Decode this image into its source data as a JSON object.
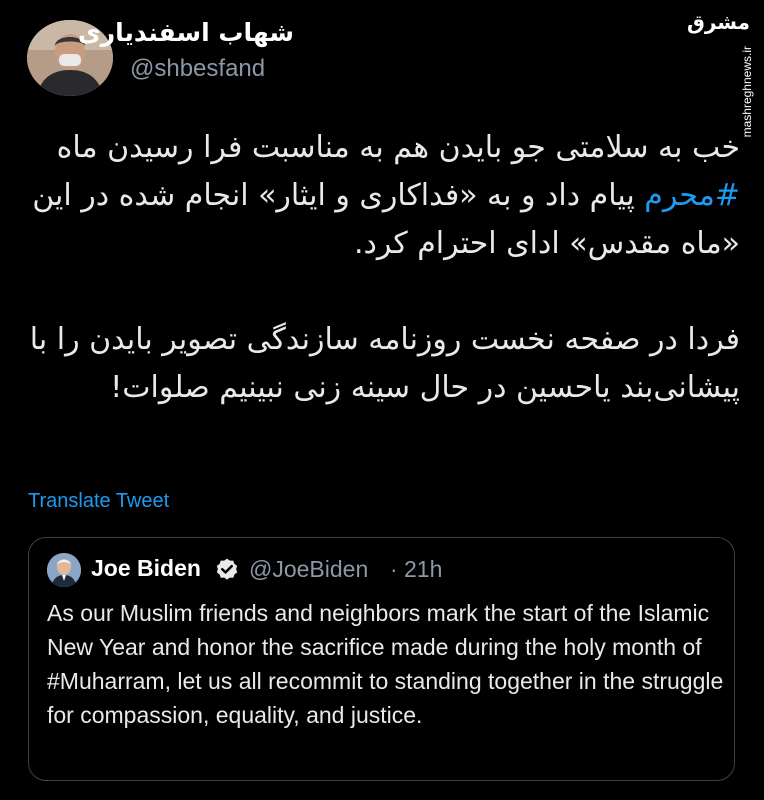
{
  "author": {
    "display_name": "شهاب اسفندیاری",
    "handle": "@shbesfand"
  },
  "watermark": {
    "logo": "مشرق",
    "site": "mashreghnews.ir"
  },
  "tweet": {
    "paragraph1_before_hashtag": "خب به سلامتی جو بایدن هم به مناسبت فرا رسیدن ماه ",
    "hashtag": "#محرم",
    "paragraph1_after_hashtag": " پیام داد و به «فداکاری و ایثار» انجام شده در این «ماه مقدس» ادای احترام کرد.",
    "paragraph2": "فردا در صفحه نخست روزنامه سازندگی تصویر بایدن را با پیشانی‌بند یاحسین در حال سینه زنی نبینیم صلوات!"
  },
  "translate_label": "Translate Tweet",
  "quoted_tweet": {
    "name": "Joe Biden",
    "handle": "@JoeBiden",
    "separator": "·",
    "time": "21h",
    "text": "As our Muslim friends and neighbors mark the start of the Islamic New Year and honor the sacrifice made during the holy month of #Muharram, let us all recommit to standing together in the struggle for compassion, equality, and justice."
  },
  "icons": {
    "author_avatar": "author-avatar-photo",
    "quoted_avatar": "biden-avatar-photo",
    "verified": "verified-badge-icon"
  },
  "colors": {
    "background": "#000000",
    "text": "#e7e9ea",
    "secondary_text": "#8b98a5",
    "link": "#1d9bf0",
    "card_border": "#3e4144"
  }
}
